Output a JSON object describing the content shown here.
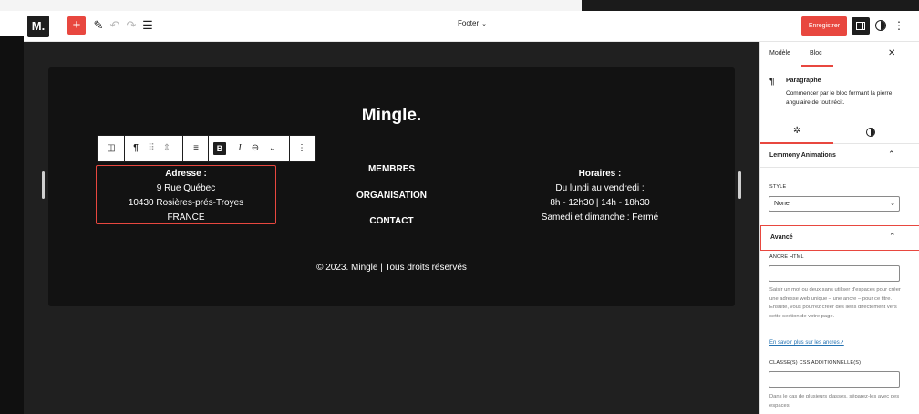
{
  "toolbar": {
    "logo": "M.",
    "add_icon": "plus-icon",
    "doc_title": "Footer",
    "save_label": "Enregistrer"
  },
  "footer": {
    "brand": "Mingle.",
    "address": {
      "label": "Adresse :",
      "street": "9 Rue Québec",
      "city": "10430 Rosières-prés-Troyes",
      "country": "FRANCE"
    },
    "nav_items": [
      "MEMBRES",
      "ORGANISATION",
      "CONTACT"
    ],
    "hours": {
      "label": "Horaires :",
      "line1": "Du lundi au vendredi :",
      "line2": "8h - 12h30 | 14h - 18h30",
      "line3": "Samedi et dimanche : Fermé"
    },
    "copyright": "© 2023. Mingle | Tous droits réservés"
  },
  "sidebar": {
    "tab_modele": "Modèle",
    "tab_bloc": "Bloc",
    "block_name": "Paragraphe",
    "block_desc": "Commencer par le bloc formant la pierre angulaire de tout récit.",
    "animations_title": "Lemmony Animations",
    "style_label": "STYLE",
    "style_value": "None",
    "advanced_title": "Avancé",
    "anchor_label": "ANCRE HTML",
    "anchor_help": "Saisir un mot ou deux sans utiliser d'espaces pour créer une adresse web unique – une ancre – pour ce titre. Ensuite, vous pourrez créer des liens directement vers cette section de votre page.",
    "anchor_link": "En savoir plus sur les ancres↗",
    "classes_label": "CLASSE(S) CSS ADDITIONNELLE(S)",
    "classes_help": "Dans le cas de plusieurs classes, séparez-les avec des espaces."
  },
  "colors": {
    "accent": "#e8473f",
    "canvas": "#202020",
    "footer_bg": "#121212"
  }
}
